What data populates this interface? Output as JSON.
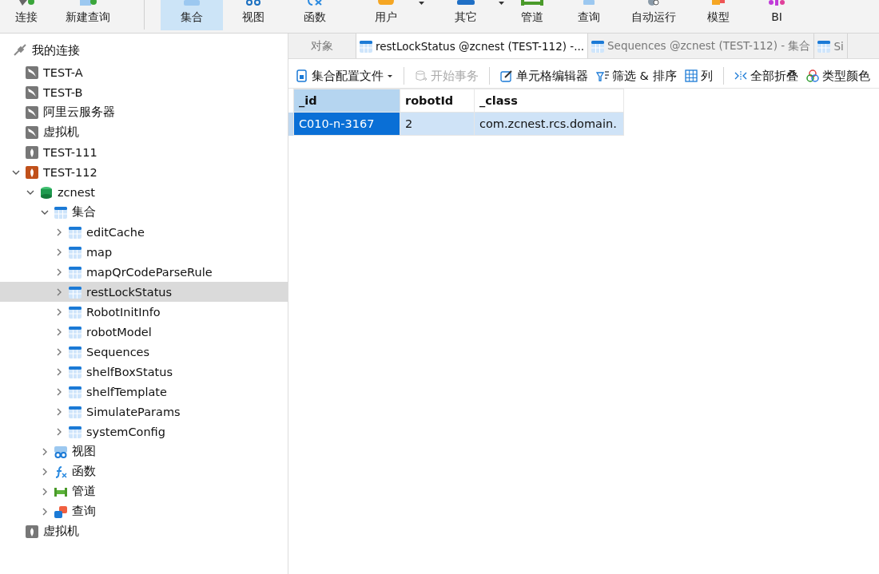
{
  "toolbar": {
    "items": [
      {
        "label": "连接",
        "selected": false,
        "dropdown": false
      },
      {
        "label": "新建查询",
        "selected": false,
        "dropdown": false
      },
      {
        "kind": "separator"
      },
      {
        "label": "集合",
        "selected": true,
        "dropdown": false
      },
      {
        "label": "视图",
        "selected": false,
        "dropdown": false
      },
      {
        "label": "函数",
        "selected": false,
        "dropdown": false
      },
      {
        "label": "用户",
        "selected": false,
        "dropdown": true
      },
      {
        "label": "其它",
        "selected": false,
        "dropdown": true
      },
      {
        "label": "管道",
        "selected": false,
        "dropdown": false
      },
      {
        "label": "查询",
        "selected": false,
        "dropdown": false
      },
      {
        "label": "自动运行",
        "selected": false,
        "dropdown": false
      },
      {
        "label": "模型",
        "selected": false,
        "dropdown": false
      },
      {
        "label": "BI",
        "selected": false,
        "dropdown": false
      }
    ]
  },
  "sidebar": {
    "title": "我的连接",
    "tree": [
      {
        "label": "TEST-A",
        "kind": "mysql",
        "connected": false,
        "selected": false
      },
      {
        "label": "TEST-B",
        "kind": "mysql",
        "connected": false,
        "selected": false
      },
      {
        "label": "阿里云服务器",
        "kind": "mysql",
        "connected": false,
        "selected": false
      },
      {
        "label": "虚拟机",
        "kind": "mysql",
        "connected": false,
        "selected": false
      },
      {
        "label": "TEST-111",
        "kind": "mongo",
        "connected": false,
        "selected": false
      },
      {
        "label": "TEST-112",
        "kind": "mongo",
        "connected": true,
        "selected": false,
        "expanded": true,
        "children": [
          {
            "label": "zcnest",
            "kind": "database",
            "selected": false,
            "expanded": true,
            "children": [
              {
                "label": "集合",
                "kind": "collection",
                "selected": false,
                "expanded": true,
                "children": [
                  {
                    "label": "editCache",
                    "kind": "collection",
                    "selected": false,
                    "expanded": false
                  },
                  {
                    "label": "map",
                    "kind": "collection",
                    "selected": false,
                    "expanded": false
                  },
                  {
                    "label": "mapQrCodeParseRule",
                    "kind": "collection",
                    "selected": false,
                    "expanded": false
                  },
                  {
                    "label": "restLockStatus",
                    "kind": "collection",
                    "selected": true,
                    "expanded": false
                  },
                  {
                    "label": "RobotInitInfo",
                    "kind": "collection",
                    "selected": false,
                    "expanded": false
                  },
                  {
                    "label": "robotModel",
                    "kind": "collection",
                    "selected": false,
                    "expanded": false
                  },
                  {
                    "label": "Sequences",
                    "kind": "collection",
                    "selected": false,
                    "expanded": false
                  },
                  {
                    "label": "shelfBoxStatus",
                    "kind": "collection",
                    "selected": false,
                    "expanded": false
                  },
                  {
                    "label": "shelfTemplate",
                    "kind": "collection",
                    "selected": false,
                    "expanded": false
                  },
                  {
                    "label": "SimulateParams",
                    "kind": "collection",
                    "selected": false,
                    "expanded": false
                  },
                  {
                    "label": "systemConfig",
                    "kind": "collection",
                    "selected": false,
                    "expanded": false
                  }
                ]
              },
              {
                "label": "视图",
                "kind": "view",
                "selected": false,
                "expanded": false
              },
              {
                "label": "函数",
                "kind": "function",
                "selected": false,
                "expanded": false
              },
              {
                "label": "管道",
                "kind": "pipeline",
                "selected": false,
                "expanded": false
              },
              {
                "label": "查询",
                "kind": "query",
                "selected": false,
                "expanded": false
              }
            ]
          }
        ]
      },
      {
        "label": "虚拟机",
        "kind": "mongo",
        "connected": false,
        "selected": false
      }
    ]
  },
  "tabs": [
    {
      "label": "对象",
      "kind": "objects",
      "selected": false
    },
    {
      "label": "restLockStatus @zcnest (TEST-112) -...",
      "kind": "collection",
      "selected": true
    },
    {
      "label": "Sequences @zcnest (TEST-112) - 集合",
      "kind": "collection",
      "selected": false
    },
    {
      "label": "Si",
      "kind": "collection",
      "selected": false
    }
  ],
  "doc_toolbar": [
    {
      "label": "集合配置文件",
      "kind": "profile",
      "dropdown": true,
      "disabled": false
    },
    {
      "kind": "separator"
    },
    {
      "label": "开始事务",
      "kind": "transaction",
      "dropdown": false,
      "disabled": true
    },
    {
      "kind": "separator"
    },
    {
      "label": "单元格编辑器",
      "kind": "edit",
      "dropdown": false,
      "disabled": false
    },
    {
      "label": "筛选 & 排序",
      "kind": "filter",
      "dropdown": false,
      "disabled": false
    },
    {
      "label": "列",
      "kind": "grid",
      "dropdown": false,
      "disabled": false
    },
    {
      "kind": "separator"
    },
    {
      "label": "全部折叠",
      "kind": "collapse",
      "dropdown": false,
      "disabled": false
    },
    {
      "label": "类型颜色",
      "kind": "colors",
      "dropdown": false,
      "disabled": false
    }
  ],
  "table": {
    "columns": [
      {
        "label": "_id",
        "selected": true
      },
      {
        "label": "robotId",
        "selected": false
      },
      {
        "label": "_class",
        "selected": false
      }
    ],
    "rows": [
      {
        "selected": true,
        "cells": [
          {
            "text": "C010-n-3167",
            "selected": true
          },
          {
            "text": "2",
            "selected": false
          },
          {
            "text": "com.zcnest.rcs.domain.",
            "selected": false
          }
        ]
      }
    ]
  }
}
